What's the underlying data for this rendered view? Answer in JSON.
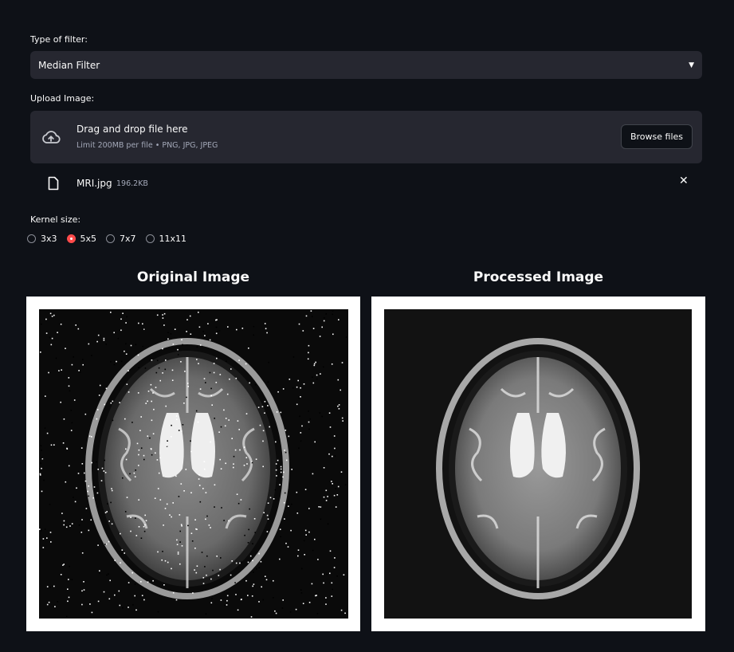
{
  "filter": {
    "label": "Type of filter:",
    "selected": "Median Filter"
  },
  "upload": {
    "label": "Upload Image:",
    "drag_text": "Drag and drop file here",
    "limit_text": "Limit 200MB per file • PNG, JPG, JPEG",
    "browse_label": "Browse files",
    "file": {
      "name": "MRI.jpg",
      "size": "196.2KB"
    }
  },
  "kernel": {
    "label": "Kernel size:",
    "options": [
      "3x3",
      "5x5",
      "7x7",
      "11x11"
    ],
    "selected": "5x5"
  },
  "images": {
    "original_title": "Original Image",
    "processed_title": "Processed Image"
  },
  "colors": {
    "accent": "#ff4b4b",
    "background": "#0e1117",
    "widget": "#262730"
  },
  "icons": {
    "dropdown": "chevron-down-icon",
    "upload": "cloud-upload-icon",
    "file": "file-icon",
    "remove": "close-icon"
  }
}
